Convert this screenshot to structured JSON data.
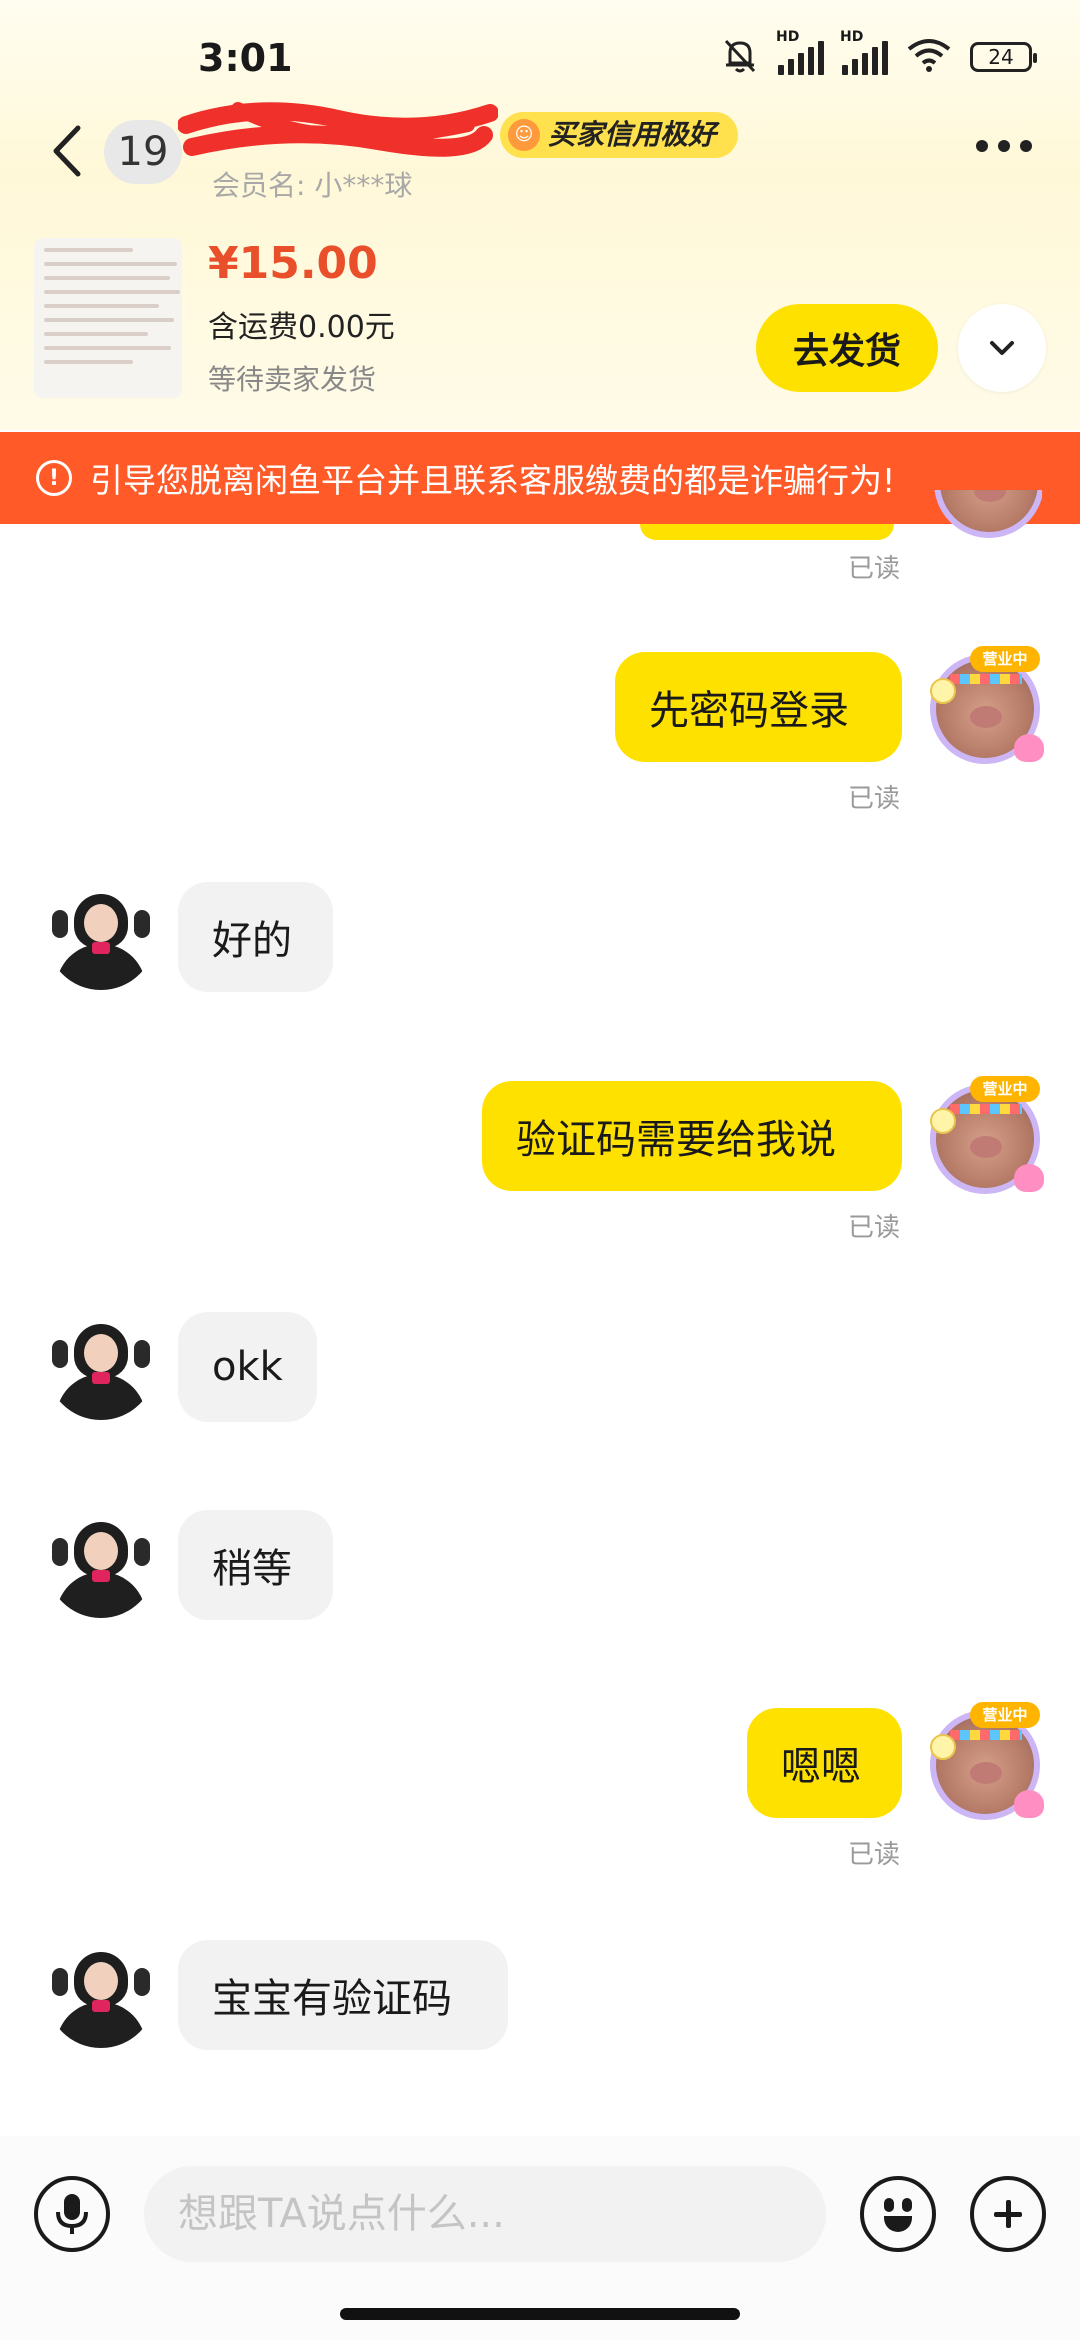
{
  "status_bar": {
    "time": "3:01",
    "battery": "24",
    "hd1": "HD",
    "hd2": "HD"
  },
  "header": {
    "unread_count": "19",
    "nickname": "",
    "credit_badge": "买家信用极好",
    "member_label": "会员名: 小***球"
  },
  "order": {
    "price": "¥15.00",
    "shipping": "含运费0.00元",
    "status": "等待卖家发货",
    "ship_button": "去发货"
  },
  "warning": "引导您脱离闲鱼平台并且联系客服缴费的都是诈骗行为!",
  "chat": {
    "read_label": "已读",
    "avatar_tag": "营业中",
    "messages": [
      {
        "from": "me",
        "text": "先密码登录"
      },
      {
        "from": "them",
        "text": "好的"
      },
      {
        "from": "me",
        "text": "验证码需要给我说"
      },
      {
        "from": "them",
        "text": "okk"
      },
      {
        "from": "them",
        "text": "稍等"
      },
      {
        "from": "me",
        "text": "嗯嗯"
      },
      {
        "from": "them",
        "text": "宝宝有验证码"
      }
    ]
  },
  "input": {
    "placeholder": "想跟TA说点什么..."
  },
  "colors": {
    "accent": "#ffe100",
    "warning": "#ff5a28",
    "price": "#e94f2a"
  },
  "icons": [
    "back-arrow-icon",
    "more-icon",
    "chevron-down-icon",
    "warning-icon",
    "microphone-icon",
    "emoji-icon",
    "plus-icon",
    "mute-bell-icon",
    "wifi-icon",
    "signal-icon",
    "battery-icon"
  ]
}
